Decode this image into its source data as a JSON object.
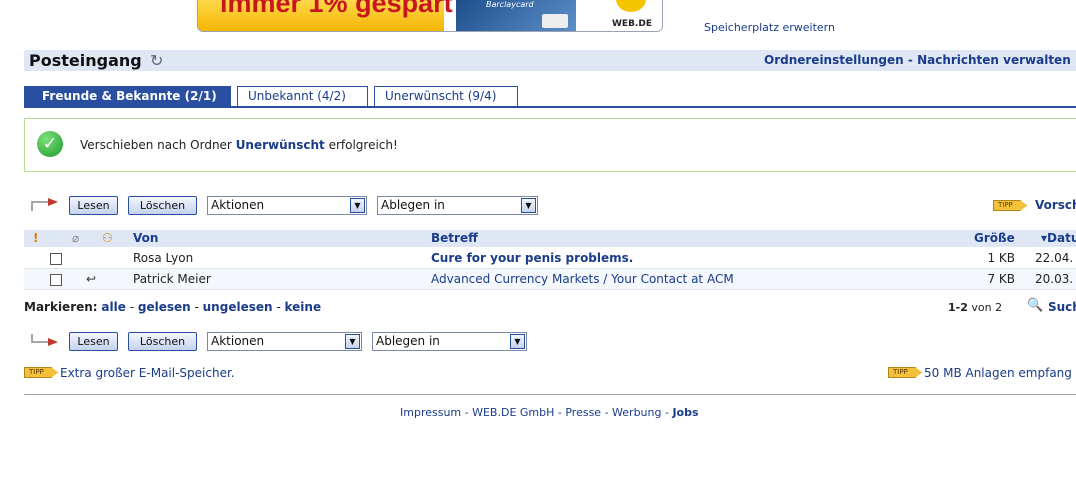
{
  "banner": {
    "ad_text": "immer 1% gespart",
    "card_text": "Barclaycard",
    "logo_text": "WEB.DE"
  },
  "storage_link": "Speicherplatz erweitern",
  "header": {
    "title": "Posteingang",
    "link_settings": "Ordnereinstellungen",
    "separator": " - ",
    "link_manage": "Nachrichten verwalten"
  },
  "tabs": [
    {
      "label": "Freunde & Bekannte (2/1)",
      "active": true
    },
    {
      "label": "Unbekannt (4/2)",
      "active": false
    },
    {
      "label": "Unerwünscht (9/4)",
      "active": false
    }
  ],
  "message": {
    "prefix": "Verschieben nach Ordner ",
    "folder": "Unerwünscht",
    "suffix": " erfolgreich!"
  },
  "toolbar": {
    "read_label": "Lesen",
    "delete_label": "Löschen",
    "actions_value": "Aktionen",
    "file_value": "Ablegen in"
  },
  "tipp_label": "TIPP",
  "preview_link": "Vorsch",
  "table": {
    "col_from": "Von",
    "col_subject": "Betreff",
    "col_size": "Größe",
    "col_date": "▾Datu",
    "rows": [
      {
        "from": "Rosa Lyon",
        "subject": "Cure for your penis problems.",
        "size": "1 KB",
        "date": "22.04.",
        "unread": true
      },
      {
        "from": "Patrick Meier",
        "subject": "Advanced Currency Markets / Your Contact at ACM",
        "size": "7 KB",
        "date": "20.03.",
        "unread": false
      }
    ]
  },
  "mark": {
    "label": "Markieren:",
    "all": "alle",
    "read": "gelesen",
    "unread": "ungelesen",
    "none": "keine",
    "sep": " - "
  },
  "pager": {
    "range": "1-2",
    "of": " von 2"
  },
  "search_link": "Such",
  "tips": {
    "left": "Extra großer E-Mail-Speicher.",
    "right": "50 MB Anlagen empfang"
  },
  "footer": {
    "impressum": "Impressum",
    "company": "WEB.DE GmbH",
    "press": "Presse",
    "ads": "Werbung",
    "jobs": "Jobs",
    "sep": " - "
  },
  "colors": {
    "accent": "#2a4fa0",
    "link": "#1a3c8a",
    "header_bg": "#dfe7f5",
    "success_border": "#b6de9a"
  }
}
